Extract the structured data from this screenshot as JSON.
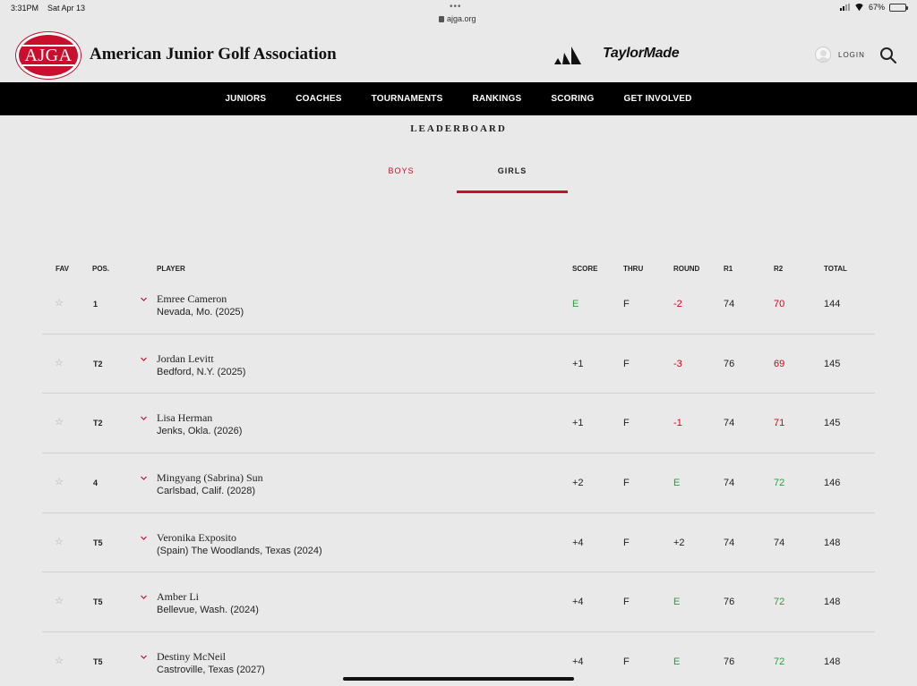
{
  "status_bar": {
    "time": "3:31PM",
    "date": "Sat Apr 13",
    "url": "ajga.org",
    "battery": "67%",
    "battery_level": 0.67
  },
  "header": {
    "logo_text": "AJGA",
    "title": "American Junior Golf Association",
    "sponsor_2": "TaylorMade",
    "login_label": "LOGIN"
  },
  "nav": {
    "items": [
      "JUNIORS",
      "COACHES",
      "TOURNAMENTS",
      "RANKINGS",
      "SCORING",
      "GET INVOLVED"
    ]
  },
  "leaderboard": {
    "title": "LEADERBOARD",
    "tabs": [
      {
        "label": "BOYS",
        "active": false
      },
      {
        "label": "GIRLS",
        "active": true
      }
    ],
    "columns": {
      "fav": "FAV",
      "pos": "POS.",
      "player": "PLAYER",
      "score": "SCORE",
      "thru": "THRU",
      "round": "ROUND",
      "r1": "R1",
      "r2": "R2",
      "total": "TOTAL"
    },
    "rows": [
      {
        "pos": "1",
        "name": "Emree Cameron",
        "home": "Nevada, Mo. (2025)",
        "score": "E",
        "thru": "F",
        "round": "-2",
        "r1": "74",
        "r2": "70",
        "total": "144"
      },
      {
        "pos": "T2",
        "name": "Jordan Levitt",
        "home": "Bedford, N.Y. (2025)",
        "score": "+1",
        "thru": "F",
        "round": "-3",
        "r1": "76",
        "r2": "69",
        "total": "145"
      },
      {
        "pos": "T2",
        "name": "Lisa Herman",
        "home": "Jenks, Okla. (2026)",
        "score": "+1",
        "thru": "F",
        "round": "-1",
        "r1": "74",
        "r2": "71",
        "total": "145"
      },
      {
        "pos": "4",
        "name": "Mingyang (Sabrina) Sun",
        "home": "Carlsbad, Calif. (2028)",
        "score": "+2",
        "thru": "F",
        "round": "E",
        "r1": "74",
        "r2": "72",
        "total": "146"
      },
      {
        "pos": "T5",
        "name": "Veronika Exposito",
        "home": "(Spain) The Woodlands, Texas (2024)",
        "score": "+4",
        "thru": "F",
        "round": "+2",
        "r1": "74",
        "r2": "74",
        "total": "148"
      },
      {
        "pos": "T5",
        "name": "Amber Li",
        "home": "Bellevue, Wash. (2024)",
        "score": "+4",
        "thru": "F",
        "round": "E",
        "r1": "76",
        "r2": "72",
        "total": "148"
      },
      {
        "pos": "T5",
        "name": "Destiny McNeil",
        "home": "Castroville, Texas (2027)",
        "score": "+4",
        "thru": "F",
        "round": "E",
        "r1": "76",
        "r2": "72",
        "total": "148"
      }
    ]
  },
  "colors": {
    "accent_red": "#c8102e",
    "under_par_red": "#d0021b",
    "even_green": "#2a9d3a",
    "nav_bg": "#000000",
    "page_bg": "#e9e9e9"
  }
}
